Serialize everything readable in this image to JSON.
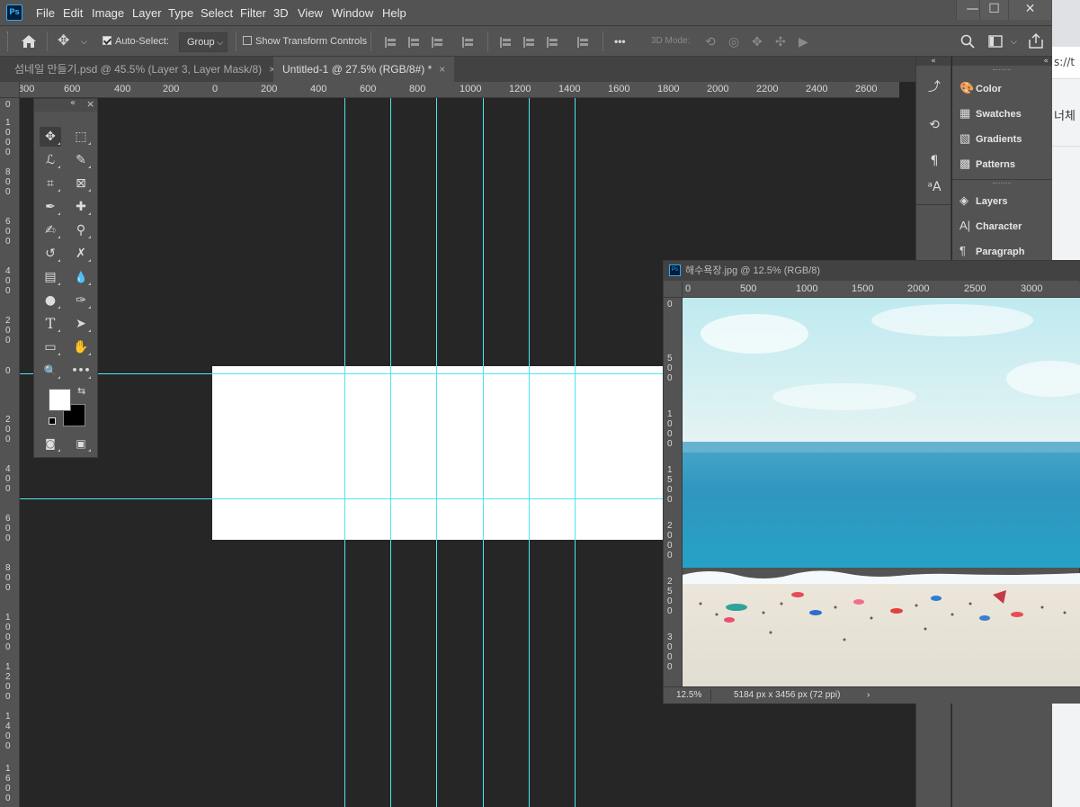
{
  "app": {
    "logo": "Ps"
  },
  "menu": [
    "File",
    "Edit",
    "Image",
    "Layer",
    "Type",
    "Select",
    "Filter",
    "3D",
    "View",
    "Window",
    "Help"
  ],
  "window_controls": {
    "minimize": "—",
    "maximize": "☐",
    "close": "✕"
  },
  "options": {
    "auto_select_label": "Auto-Select:",
    "auto_select_checked": true,
    "auto_select_target": "Group",
    "show_transform_label": "Show Transform Controls",
    "show_transform_checked": false,
    "more": "•••",
    "mode_3d_label": "3D Mode:"
  },
  "tabs": [
    {
      "label": "섬네일 만들기.psd @ 45.5% (Layer 3, Layer Mask/8)",
      "close": "×",
      "active": false
    },
    {
      "label": "Untitled-1 @ 27.5% (RGB/8#) *",
      "close": "×",
      "active": true
    }
  ],
  "hruler_labels": [
    "800",
    "600",
    "400",
    "200",
    "0",
    "200",
    "400",
    "600",
    "800",
    "1000",
    "1200",
    "1400",
    "1600",
    "1800",
    "2000",
    "2200",
    "2400",
    "2600"
  ],
  "vruler_labels": [
    "0",
    "1000",
    "800",
    "600",
    "400",
    "200",
    "0",
    "200",
    "400",
    "600",
    "800",
    "1000",
    "1200",
    "1400",
    "1600"
  ],
  "tools": {
    "move": "✥",
    "marquee": "⬚",
    "lasso": "ℒ",
    "quick_select": "✎",
    "crop": "⌗",
    "frame": "⊠",
    "eyedropper": "✒",
    "healing": "✚",
    "brush": "✍",
    "stamp": "⚲",
    "history_brush": "↺",
    "eraser": "✗",
    "gradient": "▤",
    "blur": "💧",
    "dodge": "●",
    "pen": "✑",
    "type": "T",
    "path_select": "➤",
    "shape": "▭",
    "hand": "✋",
    "zoom": "🔍",
    "more": "•••",
    "swap": "⇆",
    "quick_mask": "◙",
    "screen_mode": "▣"
  },
  "colors": {
    "foreground": "#ffffff",
    "background": "#000000",
    "guide": "#4ee6f0",
    "ui_panel": "#535353",
    "canvas_bg": "#262626"
  },
  "right_panels": [
    {
      "label": "Color",
      "icon": "palette-icon",
      "glyph": "🎨"
    },
    {
      "label": "Swatches",
      "icon": "grid-icon",
      "glyph": "▦"
    },
    {
      "label": "Gradients",
      "icon": "gradient-icon",
      "glyph": "▧"
    },
    {
      "label": "Patterns",
      "icon": "pattern-icon",
      "glyph": "▩"
    },
    {
      "label": "Layers",
      "icon": "layers-icon",
      "glyph": "◈"
    },
    {
      "label": "Character",
      "icon": "character-icon",
      "glyph": "A|"
    },
    {
      "label": "Paragraph",
      "icon": "paragraph-icon",
      "glyph": "¶"
    }
  ],
  "float_window": {
    "title": "해수욕장.jpg @ 12.5% (RGB/8)",
    "hruler_labels": [
      "0",
      "500",
      "1000",
      "1500",
      "2000",
      "2500",
      "3000"
    ],
    "vruler_labels": [
      "0",
      "500",
      "1000",
      "1500",
      "2000",
      "2500",
      "3000"
    ],
    "zoom": "12.5%",
    "dimensions": "5184 px x 3456 px (72 ppi)",
    "arrow": "›"
  },
  "browser": {
    "url_fragment": "s://t",
    "text_fragment": "너체"
  }
}
